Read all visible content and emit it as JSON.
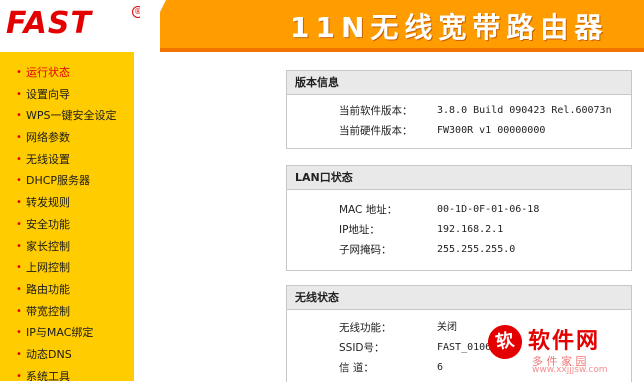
{
  "header": {
    "logo": "FAST",
    "logo_mark": "®",
    "title": "11N无线宽带路由器"
  },
  "sidebar": {
    "items": [
      {
        "label": "运行状态",
        "active": true
      },
      {
        "label": "设置向导"
      },
      {
        "label": "WPS一键安全设定"
      },
      {
        "label": "网络参数"
      },
      {
        "label": "无线设置"
      },
      {
        "label": "DHCP服务器"
      },
      {
        "label": "转发规则"
      },
      {
        "label": "安全功能"
      },
      {
        "label": "家长控制"
      },
      {
        "label": "上网控制"
      },
      {
        "label": "路由功能"
      },
      {
        "label": "带宽控制"
      },
      {
        "label": "IP与MAC绑定"
      },
      {
        "label": "动态DNS"
      },
      {
        "label": "系统工具"
      }
    ]
  },
  "version": {
    "title": "版本信息",
    "rows": [
      {
        "key": "当前软件版本：",
        "value": "3.8.0 Build 090423 Rel.60073n"
      },
      {
        "key": "当前硬件版本：",
        "value": "FW300R v1 00000000"
      }
    ]
  },
  "lan": {
    "title": "LAN口状态",
    "rows": [
      {
        "key": "MAC 地址：",
        "value": "00-1D-0F-01-06-18"
      },
      {
        "key": "IP地址：",
        "value": "192.168.2.1"
      },
      {
        "key": "子网掩码：",
        "value": "255.255.255.0"
      }
    ]
  },
  "wireless": {
    "title": "无线状态",
    "rows": [
      {
        "key": "无线功能：",
        "value": "关闭"
      },
      {
        "key": "SSID号：",
        "value": "FAST_0106"
      },
      {
        "key": "信 道：",
        "value": "6"
      }
    ]
  },
  "watermark": {
    "seal": "软",
    "name": "软件网",
    "sub": "多 件 家 园",
    "url": "www.xxjjjsw.com"
  },
  "colors": {
    "header_orange": "#ff9c00",
    "sidebar_yellow": "#ffcc00",
    "logo_red": "#e40000",
    "active_red": "#e40000"
  }
}
